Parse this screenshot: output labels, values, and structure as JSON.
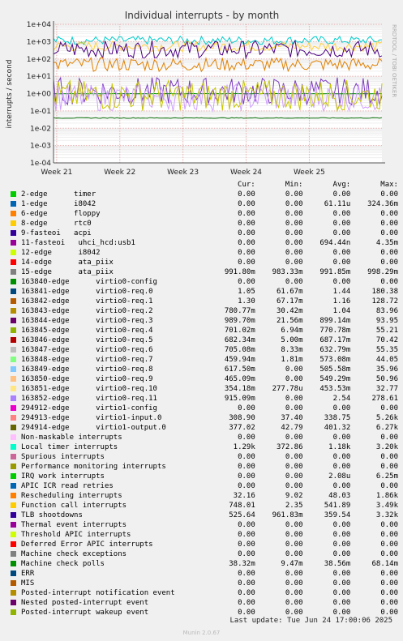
{
  "chart_data": {
    "type": "line",
    "title": "Individual interrupts - by month",
    "ylabel": "interrupts / second",
    "yscale": "log",
    "ylim": [
      0.0001,
      10000
    ],
    "yticks": [
      "1e-04",
      "1e-03",
      "1e-02",
      "1e-01",
      "1e+00",
      "1e+01",
      "1e+02",
      "1e+03",
      "1e+04"
    ],
    "xticks": [
      "Week 21",
      "Week 22",
      "Week 23",
      "Week 24",
      "Week 25"
    ],
    "grid": true,
    "side_label": "RRDTOOL / TOBI OETIKER",
    "series": [
      {
        "name": "2-edge timer",
        "color": "#00cc00",
        "level": 0,
        "noise": 0
      },
      {
        "name": "1-edge i8042",
        "color": "#0066b3",
        "level": 0,
        "noise": 0
      },
      {
        "name": "8-edge rtc0",
        "color": "#ffcc00",
        "level": 0,
        "noise": 0
      },
      {
        "name": "9-fasteoi acpi",
        "color": "#330099",
        "level": 0,
        "noise": 0
      },
      {
        "name": "15-edge ata_piix",
        "color": "#008f00",
        "level": 0.99,
        "noise": 0.01
      },
      {
        "name": "Local timer interrupts",
        "color": "#00cccc",
        "level": 1180,
        "noise": 0.25
      },
      {
        "name": "Function call interrupts",
        "color": "#ffd040",
        "level": 540,
        "noise": 0.3
      },
      {
        "name": "TLB shootdowns",
        "color": "#4b0082",
        "level": 360,
        "noise": 0.5
      },
      {
        "name": "Rescheduling interrupts",
        "color": "#e08000",
        "level": 48,
        "noise": 0.4
      },
      {
        "name": "163841-edge virtio0-req.0",
        "color": "#7c3bbf",
        "level": 1.4,
        "noise": 0.8
      },
      {
        "name": "163848-edge virtio0-req.7",
        "color": "#d0a0ff",
        "level": 0.6,
        "noise": 0.8
      },
      {
        "name": "163852-edge virtio0-req.11",
        "color": "#c8c800",
        "level": 0.8,
        "noise": 0.9
      },
      {
        "name": "Machine check polls",
        "color": "#006600",
        "level": 0.039,
        "noise": 0.02
      }
    ]
  },
  "legend": {
    "headers": {
      "cur": "Cur:",
      "min": "Min:",
      "avg": "Avg:",
      "max": "Max:"
    },
    "rows": [
      {
        "label": "2-edge      timer",
        "color": "#00cc00",
        "cur": "0.00",
        "min": "0.00",
        "avg": "0.00",
        "max": "0.00"
      },
      {
        "label": "1-edge      i8042",
        "color": "#0066b3",
        "cur": "0.00",
        "min": "0.00",
        "avg": "61.11u",
        "max": "324.36m"
      },
      {
        "label": "6-edge      floppy",
        "color": "#ff8000",
        "cur": "0.00",
        "min": "0.00",
        "avg": "0.00",
        "max": "0.00"
      },
      {
        "label": "8-edge      rtc0",
        "color": "#ffcc00",
        "cur": "0.00",
        "min": "0.00",
        "avg": "0.00",
        "max": "0.00"
      },
      {
        "label": "9-fasteoi   acpi",
        "color": "#330099",
        "cur": "0.00",
        "min": "0.00",
        "avg": "0.00",
        "max": "0.00"
      },
      {
        "label": "11-fasteoi   uhci_hcd:usb1",
        "color": "#990099",
        "cur": "0.00",
        "min": "0.00",
        "avg": "694.44n",
        "max": "4.35m"
      },
      {
        "label": "12-edge      i8042",
        "color": "#ccff00",
        "cur": "0.00",
        "min": "0.00",
        "avg": "0.00",
        "max": "0.00"
      },
      {
        "label": "14-edge      ata_piix",
        "color": "#ff0000",
        "cur": "0.00",
        "min": "0.00",
        "avg": "0.00",
        "max": "0.00"
      },
      {
        "label": "15-edge      ata_piix",
        "color": "#808080",
        "cur": "991.80m",
        "min": "983.33m",
        "avg": "991.85m",
        "max": "998.29m"
      },
      {
        "label": "163840-edge      virtio0-config",
        "color": "#008f00",
        "cur": "0.00",
        "min": "0.00",
        "avg": "0.00",
        "max": "0.00"
      },
      {
        "label": "163841-edge      virtio0-req.0",
        "color": "#00487d",
        "cur": "1.05",
        "min": "61.67m",
        "avg": "1.44",
        "max": "180.38"
      },
      {
        "label": "163842-edge      virtio0-req.1",
        "color": "#b35a00",
        "cur": "1.30",
        "min": "67.17m",
        "avg": "1.16",
        "max": "128.72"
      },
      {
        "label": "163843-edge      virtio0-req.2",
        "color": "#b38f00",
        "cur": "780.77m",
        "min": "30.42m",
        "avg": "1.04",
        "max": "83.96"
      },
      {
        "label": "163844-edge      virtio0-req.3",
        "color": "#6b006b",
        "cur": "989.70m",
        "min": "21.56m",
        "avg": "899.14m",
        "max": "93.95"
      },
      {
        "label": "163845-edge      virtio0-req.4",
        "color": "#8fb300",
        "cur": "701.02m",
        "min": "6.94m",
        "avg": "770.78m",
        "max": "55.21"
      },
      {
        "label": "163846-edge      virtio0-req.5",
        "color": "#b30000",
        "cur": "682.34m",
        "min": "5.00m",
        "avg": "687.17m",
        "max": "70.42"
      },
      {
        "label": "163847-edge      virtio0-req.6",
        "color": "#bebebe",
        "cur": "705.08m",
        "min": "8.33m",
        "avg": "632.79m",
        "max": "55.35"
      },
      {
        "label": "163848-edge      virtio0-req.7",
        "color": "#80ff80",
        "cur": "459.94m",
        "min": "1.81m",
        "avg": "573.08m",
        "max": "44.05"
      },
      {
        "label": "163849-edge      virtio0-req.8",
        "color": "#80c9ff",
        "cur": "617.50m",
        "min": "0.00",
        "avg": "505.58m",
        "max": "35.96"
      },
      {
        "label": "163850-edge      virtio0-req.9",
        "color": "#ffc080",
        "cur": "465.09m",
        "min": "0.00",
        "avg": "549.29m",
        "max": "50.96"
      },
      {
        "label": "163851-edge      virtio0-req.10",
        "color": "#ffe680",
        "cur": "354.18m",
        "min": "277.78u",
        "avg": "453.53m",
        "max": "32.77"
      },
      {
        "label": "163852-edge      virtio0-req.11",
        "color": "#aa80ff",
        "cur": "915.09m",
        "min": "0.00",
        "avg": "2.54",
        "max": "278.61"
      },
      {
        "label": "294912-edge      virtio1-config",
        "color": "#ee00cc",
        "cur": "0.00",
        "min": "0.00",
        "avg": "0.00",
        "max": "0.00"
      },
      {
        "label": "294913-edge      virtio1-input.0",
        "color": "#ff8080",
        "cur": "308.90",
        "min": "37.40",
        "avg": "338.75",
        "max": "5.26k"
      },
      {
        "label": "294914-edge      virtio1-output.0",
        "color": "#666600",
        "cur": "377.02",
        "min": "42.79",
        "avg": "401.32",
        "max": "6.27k"
      },
      {
        "label": "Non-maskable interrupts",
        "color": "#ffbfff",
        "cur": "0.00",
        "min": "0.00",
        "avg": "0.00",
        "max": "0.00"
      },
      {
        "label": "Local timer interrupts",
        "color": "#00ffcc",
        "cur": "1.29k",
        "min": "372.86",
        "avg": "1.18k",
        "max": "3.20k"
      },
      {
        "label": "Spurious interrupts",
        "color": "#cc6699",
        "cur": "0.00",
        "min": "0.00",
        "avg": "0.00",
        "max": "0.00"
      },
      {
        "label": "Performance monitoring interrupts",
        "color": "#999900",
        "cur": "0.00",
        "min": "0.00",
        "avg": "0.00",
        "max": "0.00"
      },
      {
        "label": "IRQ work interrupts",
        "color": "#00cc00",
        "cur": "0.00",
        "min": "0.00",
        "avg": "2.08u",
        "max": "6.25m"
      },
      {
        "label": "APIC ICR read retries",
        "color": "#0066b3",
        "cur": "0.00",
        "min": "0.00",
        "avg": "0.00",
        "max": "0.00"
      },
      {
        "label": "Rescheduling interrupts",
        "color": "#ff8000",
        "cur": "32.16",
        "min": "9.02",
        "avg": "48.03",
        "max": "1.86k"
      },
      {
        "label": "Function call interrupts",
        "color": "#ffcc00",
        "cur": "748.01",
        "min": "2.35",
        "avg": "541.89",
        "max": "3.49k"
      },
      {
        "label": "TLB shootdowns",
        "color": "#330099",
        "cur": "525.64",
        "min": "961.83m",
        "avg": "359.54",
        "max": "3.32k"
      },
      {
        "label": "Thermal event interrupts",
        "color": "#990099",
        "cur": "0.00",
        "min": "0.00",
        "avg": "0.00",
        "max": "0.00"
      },
      {
        "label": "Threshold APIC interrupts",
        "color": "#ccff00",
        "cur": "0.00",
        "min": "0.00",
        "avg": "0.00",
        "max": "0.00"
      },
      {
        "label": "Deferred Error APIC interrupts",
        "color": "#ff0000",
        "cur": "0.00",
        "min": "0.00",
        "avg": "0.00",
        "max": "0.00"
      },
      {
        "label": "Machine check exceptions",
        "color": "#808080",
        "cur": "0.00",
        "min": "0.00",
        "avg": "0.00",
        "max": "0.00"
      },
      {
        "label": "Machine check polls",
        "color": "#008f00",
        "cur": "38.32m",
        "min": "9.47m",
        "avg": "38.56m",
        "max": "68.14m"
      },
      {
        "label": "ERR",
        "color": "#00487d",
        "cur": "0.00",
        "min": "0.00",
        "avg": "0.00",
        "max": "0.00"
      },
      {
        "label": "MIS",
        "color": "#b35a00",
        "cur": "0.00",
        "min": "0.00",
        "avg": "0.00",
        "max": "0.00"
      },
      {
        "label": "Posted-interrupt notification event",
        "color": "#b38f00",
        "cur": "0.00",
        "min": "0.00",
        "avg": "0.00",
        "max": "0.00"
      },
      {
        "label": "Nested posted-interrupt event",
        "color": "#6b006b",
        "cur": "0.00",
        "min": "0.00",
        "avg": "0.00",
        "max": "0.00"
      },
      {
        "label": "Posted-interrupt wakeup event",
        "color": "#8fb300",
        "cur": "0.00",
        "min": "0.00",
        "avg": "0.00",
        "max": "0.00"
      }
    ]
  },
  "footer": {
    "last_update": "Last update: Tue Jun 24 17:00:06 2025",
    "version": "Munin 2.0.67"
  }
}
